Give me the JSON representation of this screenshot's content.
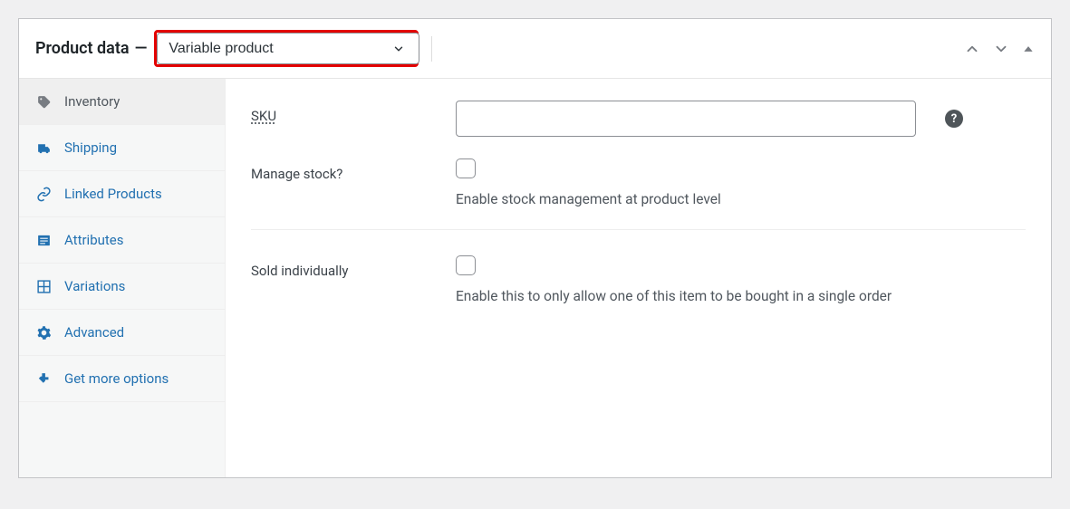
{
  "panel": {
    "title": "Product data",
    "product_type": "Variable product",
    "controls": {
      "up": "chevron-up",
      "down": "chevron-down",
      "collapse": "triangle-up"
    }
  },
  "sidebar": {
    "items": [
      {
        "id": "inventory",
        "label": "Inventory",
        "icon": "tag-icon",
        "active": true
      },
      {
        "id": "shipping",
        "label": "Shipping",
        "icon": "truck-icon",
        "active": false
      },
      {
        "id": "linked",
        "label": "Linked Products",
        "icon": "link-icon",
        "active": false
      },
      {
        "id": "attributes",
        "label": "Attributes",
        "icon": "list-icon",
        "active": false
      },
      {
        "id": "variations",
        "label": "Variations",
        "icon": "grid-icon",
        "active": false
      },
      {
        "id": "advanced",
        "label": "Advanced",
        "icon": "gear-icon",
        "active": false
      },
      {
        "id": "more",
        "label": "Get more options",
        "icon": "plug-icon",
        "active": false
      }
    ]
  },
  "form": {
    "sku": {
      "label": "SKU",
      "value": "",
      "placeholder": ""
    },
    "manage_stock": {
      "label": "Manage stock?",
      "desc": "Enable stock management at product level",
      "checked": false
    },
    "sold_individually": {
      "label": "Sold individually",
      "desc": "Enable this to only allow one of this item to be bought in a single order",
      "checked": false
    }
  },
  "help_icon_glyph": "?"
}
